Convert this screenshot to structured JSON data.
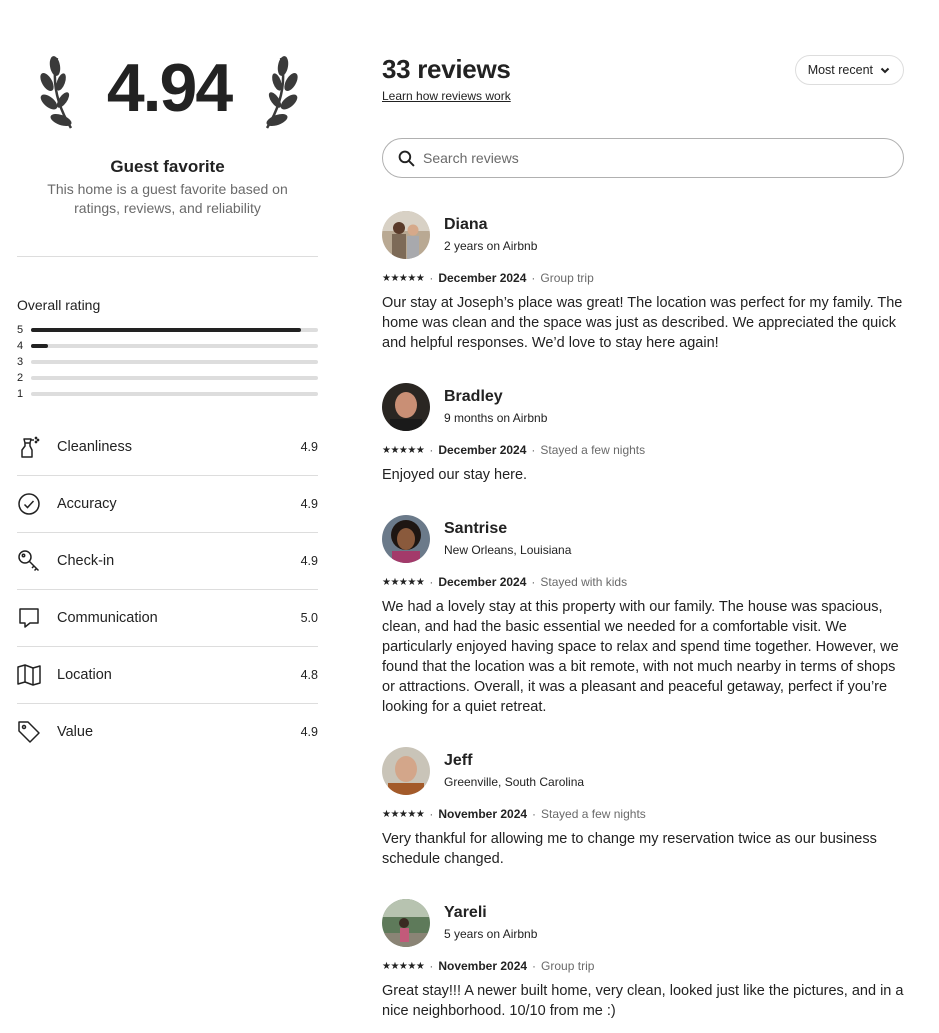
{
  "summary": {
    "score": "4.94",
    "title": "Guest favorite",
    "description": "This home is a guest favorite based on ratings, reviews, and reliability"
  },
  "overall": {
    "title": "Overall rating",
    "bars": [
      {
        "label": "5",
        "fraction": 0.94
      },
      {
        "label": "4",
        "fraction": 0.06
      },
      {
        "label": "3",
        "fraction": 0
      },
      {
        "label": "2",
        "fraction": 0
      },
      {
        "label": "1",
        "fraction": 0
      }
    ]
  },
  "categories": [
    {
      "label": "Cleanliness",
      "value": "4.9",
      "icon": "spray-bottle-icon"
    },
    {
      "label": "Accuracy",
      "value": "4.9",
      "icon": "check-circle-icon"
    },
    {
      "label": "Check-in",
      "value": "4.9",
      "icon": "key-icon"
    },
    {
      "label": "Communication",
      "value": "5.0",
      "icon": "chat-bubble-icon"
    },
    {
      "label": "Location",
      "value": "4.8",
      "icon": "map-icon"
    },
    {
      "label": "Value",
      "value": "4.9",
      "icon": "tag-icon"
    }
  ],
  "reviews_header": {
    "title": "33 reviews",
    "learn_link": "Learn how reviews work",
    "sort_label": "Most recent",
    "search_placeholder": "Search reviews"
  },
  "reviews": [
    {
      "name": "Diana",
      "subtitle": "2 years on Airbnb",
      "stars": "★★★★★",
      "date": "December 2024",
      "trip": "Group trip",
      "text": "Our stay at Joseph’s place was great! The location was perfect for my family. The home was clean and the space was just as described. We appreciated the quick and helpful responses. We’d love to stay here again!"
    },
    {
      "name": "Bradley",
      "subtitle": "9 months on Airbnb",
      "stars": "★★★★★",
      "date": "December 2024",
      "trip": "Stayed a few nights",
      "text": "Enjoyed our stay here."
    },
    {
      "name": "Santrise",
      "subtitle": "New Orleans, Louisiana",
      "stars": "★★★★★",
      "date": "December 2024",
      "trip": "Stayed with kids",
      "text": "We had a lovely stay at this property with our family. The house was spacious, clean, and had the basic essential we needed for a comfortable visit. We particularly enjoyed having space to relax and spend time together. However, we found that the location was a bit remote, with not much nearby in terms of shops or attractions. Overall, it was a pleasant and peaceful getaway, perfect if you’re looking for a quiet retreat."
    },
    {
      "name": "Jeff",
      "subtitle": "Greenville, South Carolina",
      "stars": "★★★★★",
      "date": "November 2024",
      "trip": "Stayed a few nights",
      "text": "Very thankful for allowing me to change my reservation twice as our business schedule changed."
    },
    {
      "name": "Yareli",
      "subtitle": "5 years on Airbnb",
      "stars": "★★★★★",
      "date": "November 2024",
      "trip": "Group trip",
      "text": "Great stay!!! A newer built home, very clean, looked just like the pictures, and in a nice neighborhood. 10/10 from me :)"
    }
  ],
  "meta_separator": "·"
}
